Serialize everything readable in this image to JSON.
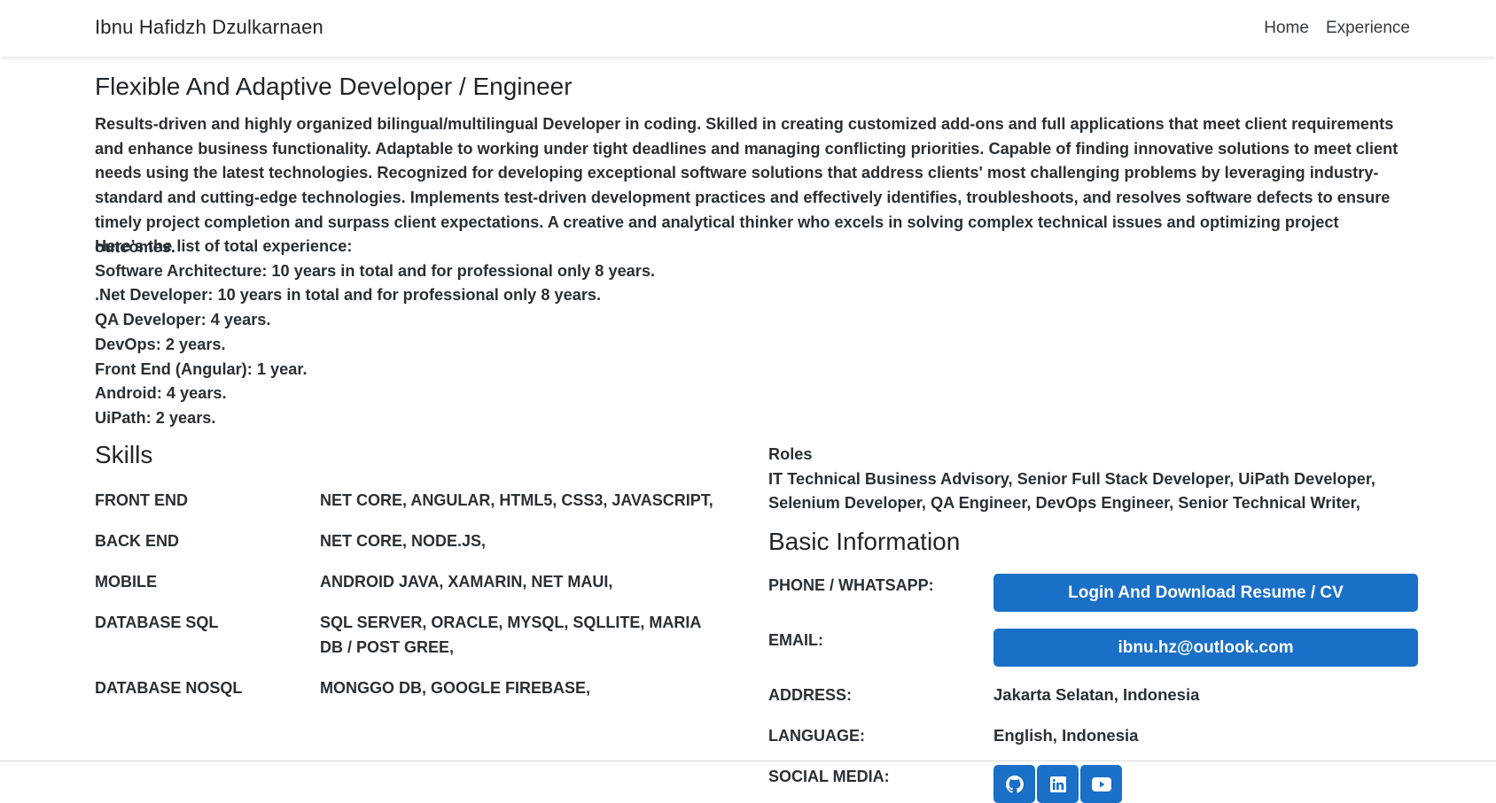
{
  "navbar": {
    "brand": "Ibnu Hafidzh Dzulkarnaen",
    "links": [
      "Home",
      "Experience"
    ]
  },
  "profile": {
    "headline": "Flexible And Adaptive Developer / Engineer",
    "summary": "Results-driven and highly organized bilingual/multilingual Developer in coding. Skilled in creating customized add-ons and full applications that meet client requirements and enhance business functionality. Adaptable to working under tight deadlines and managing conflicting priorities. Capable of finding innovative solutions to meet client needs using the latest technologies. Recognized for developing exceptional software solutions that address clients' most challenging problems by leveraging industry-standard and cutting-edge technologies. Implements test-driven development practices and effectively identifies, troubleshoots, and resolves software defects to ensure timely project completion and surpass client expectations. A creative and analytical thinker who excels in solving complex technical issues and optimizing project outcomes.",
    "experience": [
      "Here’s the list of total experience:",
      "Software Architecture: 10 years in total and for professional only 8 years.",
      ".Net Developer: 10 years in total and for professional only 8 years.",
      "QA Developer: 4 years.",
      "DevOps: 2 years.",
      "Front End (Angular): 1 year.",
      "Android: 4 years.",
      "UiPath: 2 years."
    ]
  },
  "skills": {
    "title": "Skills",
    "rows": [
      {
        "category": "FRONT END",
        "value": "NET CORE, ANGULAR, HTML5, CSS3, JAVASCRIPT,"
      },
      {
        "category": "BACK END",
        "value": "NET CORE, NODE.JS,"
      },
      {
        "category": "MOBILE",
        "value": "ANDROID JAVA, XAMARIN, NET MAUI,"
      },
      {
        "category": "DATABASE SQL",
        "value": "SQL SERVER, ORACLE, MYSQL, SQLLITE, MARIA DB / POST GREE,"
      },
      {
        "category": "DATABASE NOSQL",
        "value": "MONGGO DB, GOOGLE FIREBASE,"
      }
    ]
  },
  "roles": {
    "label": "Roles",
    "value": "IT Technical Business Advisory, Senior Full Stack Developer, UiPath Developer, Selenium Developer, QA Engineer, DevOps Engineer, Senior Technical Writer,"
  },
  "basic_info": {
    "title": "Basic Information",
    "phone_label": "PHONE / WHATSAPP:",
    "phone_button": "Login And Download Resume / CV",
    "email_label": "EMAIL:",
    "email_button": "ibnu.hz@outlook.com",
    "address_label": "ADDRESS:",
    "address_value": "Jakarta Selatan, Indonesia",
    "language_label": "LANGUAGE:",
    "language_value": "English, Indonesia",
    "social_label": "SOCIAL MEDIA:",
    "social_icons": [
      "github-icon",
      "linkedin-icon",
      "youtube-icon"
    ]
  },
  "colors": {
    "accent": "#1a6fc7",
    "text": "#212529"
  }
}
